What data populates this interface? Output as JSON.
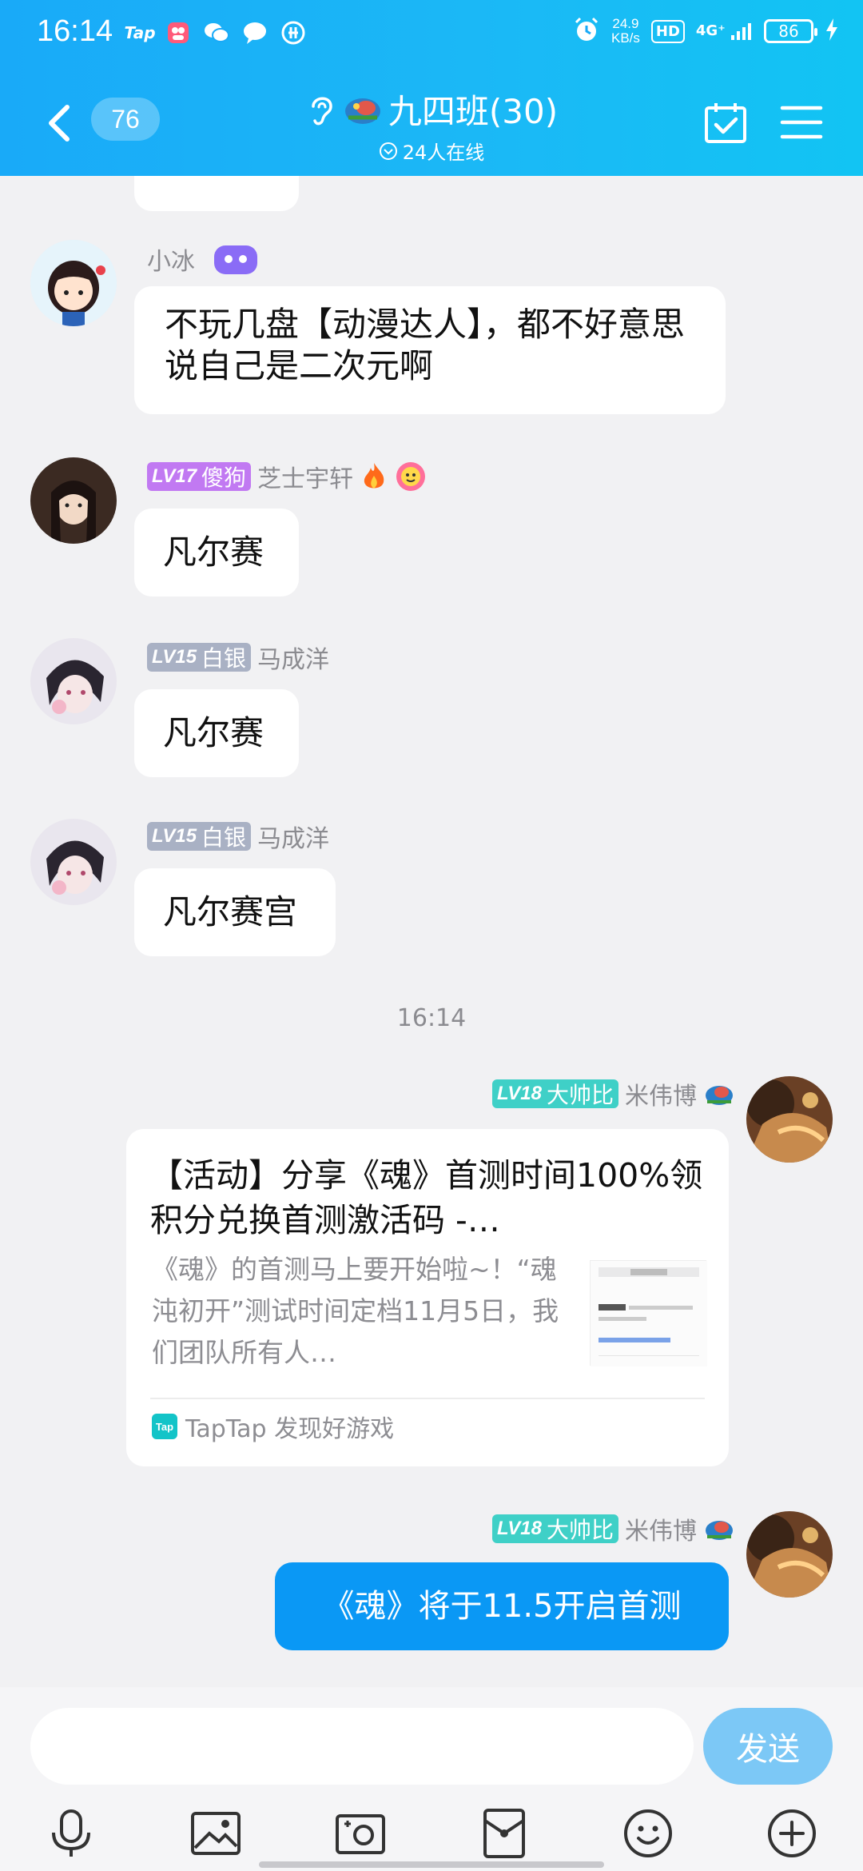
{
  "status": {
    "time": "16:14",
    "tap_label": "Tap",
    "net_speed_value": "24.9",
    "net_speed_unit": "KB/s",
    "hd": "HD",
    "signal": "4G⁺",
    "battery": "86"
  },
  "header": {
    "unread_count": "76",
    "group_title": "九四班(30)",
    "online_text": "24人在线"
  },
  "messages": {
    "m1": {
      "sender": "小冰",
      "text": "不玩几盘【动漫达人】，都不好意思说自己是二次元啊"
    },
    "m2": {
      "level": "LV17",
      "title": "傻狗",
      "sender": "芝士宇轩",
      "text": "凡尔赛"
    },
    "m3": {
      "level": "LV15",
      "title": "白银",
      "sender": "马成洋",
      "text": "凡尔赛"
    },
    "m4": {
      "level": "LV15",
      "title": "白银",
      "sender": "马成洋",
      "text": "凡尔赛宫"
    },
    "timestamp": "16:14",
    "m5": {
      "level": "LV18",
      "title": "大帅比",
      "sender": "米伟博",
      "card_title": "【活动】分享《魂》首测时间100%领积分兑换首测激活码 -…",
      "card_desc": "《魂》的首测马上要开始啦~！“魂沌初开”测试时间定档11月5日，我们团队所有人…",
      "card_source": "TapTap 发现好游戏",
      "tap_logo": "Tap"
    },
    "m6": {
      "level": "LV18",
      "title": "大帅比",
      "sender": "米伟博",
      "text": "《魂》将于11.5开启首测"
    }
  },
  "input": {
    "placeholder": "",
    "send_label": "发送"
  },
  "colors": {
    "header_blue": "#19aaf8",
    "lv17": "#c179f2",
    "lv15": "#a9b1c4",
    "lv18": "#3fd0c7",
    "self_bubble": "#0a98f5",
    "send_button": "#7cc8f6"
  },
  "icons": {
    "toolbar": [
      "microphone-icon",
      "image-icon",
      "camera-icon",
      "red-packet-icon",
      "emoji-icon",
      "plus-icon"
    ]
  }
}
